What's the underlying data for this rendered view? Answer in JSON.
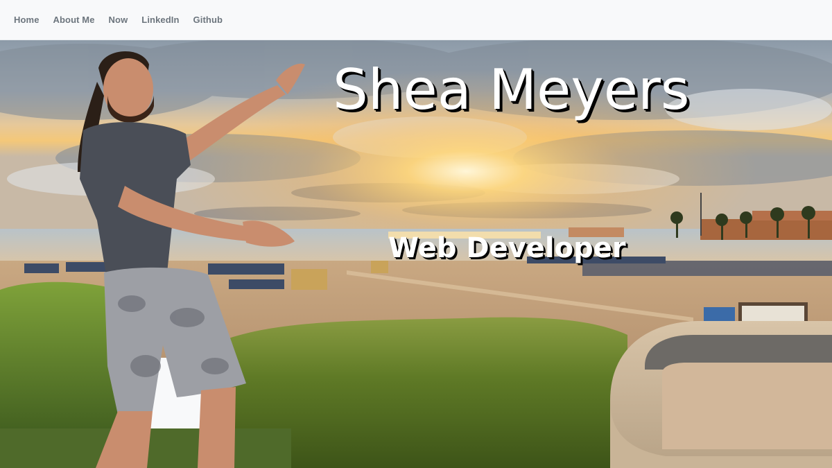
{
  "nav": {
    "items": [
      {
        "label": "Home"
      },
      {
        "label": "About Me"
      },
      {
        "label": "Now"
      },
      {
        "label": "LinkedIn"
      },
      {
        "label": "Github"
      }
    ]
  },
  "hero": {
    "title": "Shea Meyers",
    "subtitle": "Web Developer",
    "image_description_icon": "hero-photo"
  },
  "colors": {
    "nav_background": "#f8f9fa",
    "nav_text": "#6c757d",
    "title_text": "#ffffff",
    "title_shadow": "#000000"
  }
}
